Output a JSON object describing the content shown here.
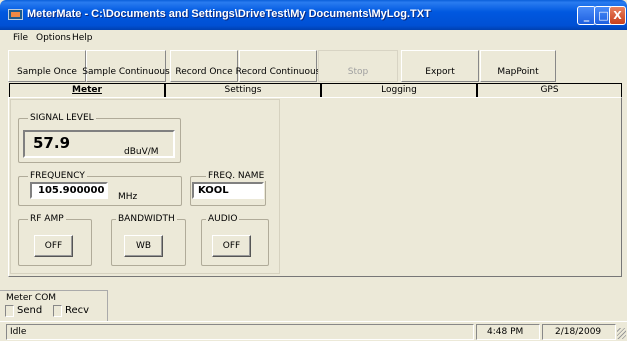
{
  "window": {
    "title": "MeterMate - C:\\Documents and Settings\\DriveTest\\My Documents\\MyLog.TXT",
    "minimize_glyph": "_",
    "maximize_glyph": "□",
    "close_glyph": "X",
    "app_icon": "metermate-app-icon"
  },
  "menu": [
    "File",
    "Options",
    "Help"
  ],
  "toolbar": {
    "buttons": [
      "Sample Once",
      "Sample Continuous",
      "Record Once",
      "Record Continuous",
      "Stop",
      "Export",
      "MapPoint"
    ]
  },
  "tabs": [
    {
      "label": "Meter",
      "active": true
    },
    {
      "label": "Settings",
      "active": false
    },
    {
      "label": "Logging",
      "active": false
    },
    {
      "label": "GPS",
      "active": false
    }
  ],
  "signal": {
    "group_label": "SIGNAL LEVEL",
    "value": "57.9",
    "unit": "dBuV/M"
  },
  "frequency": {
    "group_label": "FREQUENCY",
    "value": "105.900000",
    "unit": "MHz"
  },
  "freq_name": {
    "group_label": "FREQ. NAME",
    "value": "KOOL"
  },
  "rf_amp": {
    "group_label": "RF AMP",
    "button": "OFF"
  },
  "bandwidth": {
    "group_label": "BANDWIDTH",
    "button": "WB"
  },
  "audio": {
    "group_label": "AUDIO",
    "button": "OFF"
  },
  "meter_com": {
    "label": "Meter COM",
    "send": "Send",
    "recv": "Recv"
  },
  "status": {
    "text": "Idle",
    "time": "4:48 PM",
    "date": "2/18/2009"
  }
}
